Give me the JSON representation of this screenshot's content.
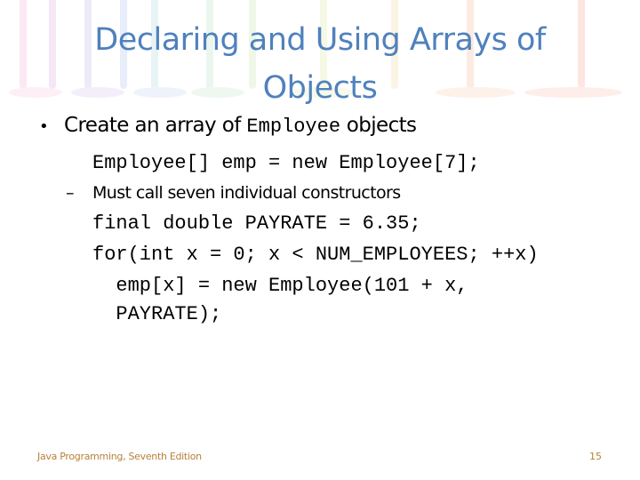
{
  "slide": {
    "title": "Declaring and Using Arrays of Objects",
    "bullet": {
      "text_before": "Create an array of ",
      "code_word": "Employee",
      "text_after": " objects"
    },
    "code_line_1": "Employee[] emp = new Employee[7];",
    "sub_bullet": "Must call seven individual constructors",
    "code_block": [
      "final double PAYRATE = 6.35;",
      "for(int x = 0; x < NUM_EMPLOYEES; ++x)",
      "  emp[x] = new Employee(101 + x,",
      "  PAYRATE);"
    ]
  },
  "footer": {
    "book_title": "Java Programming, Seventh Edition",
    "page_number": "15"
  },
  "colors": {
    "title": "#4f81bd",
    "footer": "#b8803a"
  }
}
